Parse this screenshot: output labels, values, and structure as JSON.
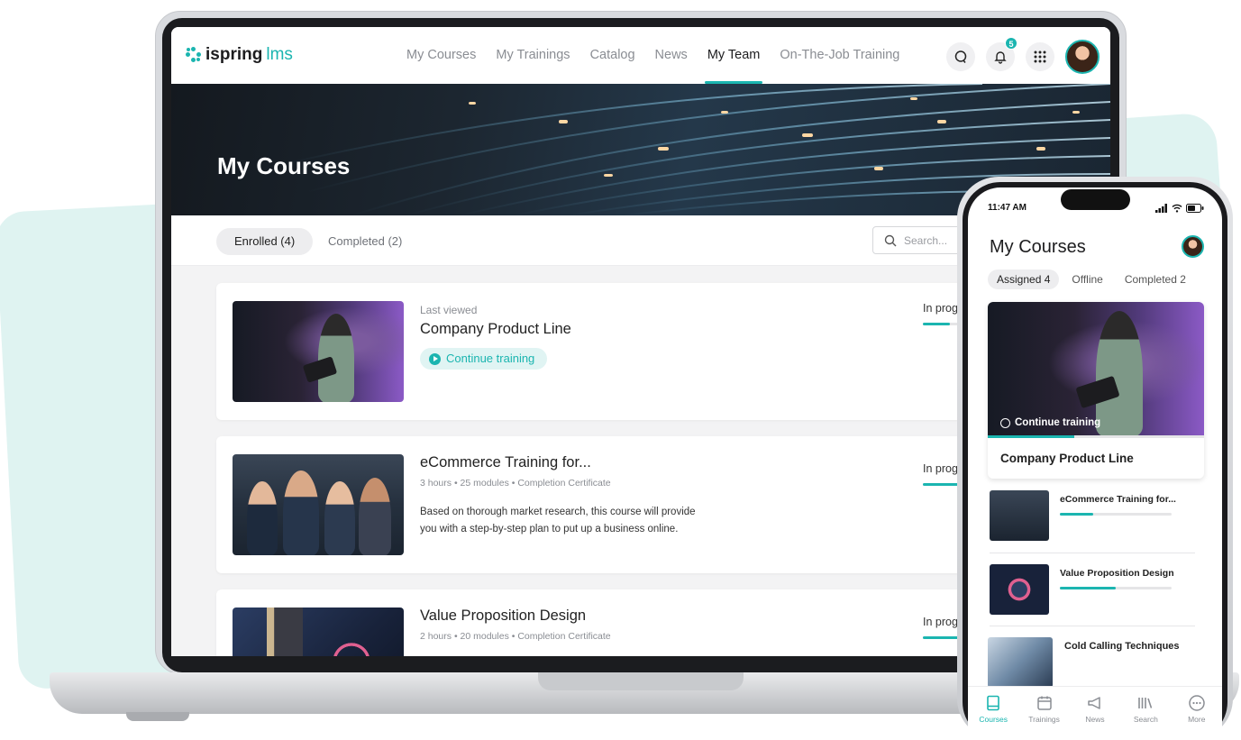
{
  "brand": {
    "name": "ispring",
    "suffix": "lms",
    "accent": "#1bb5b0"
  },
  "nav": {
    "items": [
      {
        "label": "My Courses"
      },
      {
        "label": "My Trainings"
      },
      {
        "label": "Catalog"
      },
      {
        "label": "News"
      },
      {
        "label": "My Team",
        "active": true
      },
      {
        "label": "On-The-Job Training"
      }
    ],
    "notifications_count": "5",
    "icons": [
      "chat-icon",
      "bell-icon",
      "apps-grid-icon",
      "user-avatar"
    ]
  },
  "banner": {
    "title": "My Courses"
  },
  "tabs": [
    {
      "label": "Enrolled (4)",
      "active": true
    },
    {
      "label": "Completed (2)",
      "active": false
    }
  ],
  "search": {
    "placeholder": "Search..."
  },
  "courses": [
    {
      "meta": "Last viewed",
      "title": "Company Product Line",
      "action": "Continue training",
      "status": "In prog",
      "progress": 0.5
    },
    {
      "title": "eCommerce Training for...",
      "meta": "3 hours • 25 modules  •  Completion Certificate",
      "description": "Based on thorough market research, this course will provide you with a step-by-step plan to put up a business online.",
      "status": "In prog",
      "progress": 0.7
    },
    {
      "title": "Value Proposition Design",
      "meta": "2 hours • 20 modules  •  Completion Certificate",
      "status": "In prog",
      "progress": 0.7
    }
  ],
  "phone": {
    "time": "11:47 AM",
    "title": "My Courses",
    "tabs": [
      {
        "label": "Assigned 4",
        "active": true
      },
      {
        "label": "Offline",
        "active": false
      },
      {
        "label": "Completed 2",
        "active": false
      }
    ],
    "hero": {
      "action": "Continue training",
      "title": "Company Product Line",
      "progress": 0.4
    },
    "list": [
      {
        "title": "eCommerce Training for...",
        "progress": 0.3
      },
      {
        "title": "Value Proposition Design",
        "progress": 0.5
      },
      {
        "title": "Cold Calling Techniques"
      }
    ],
    "bottom_nav": [
      {
        "label": "Courses",
        "icon": "book-icon",
        "active": true
      },
      {
        "label": "Trainings",
        "icon": "calendar-icon",
        "active": false
      },
      {
        "label": "News",
        "icon": "megaphone-icon",
        "active": false
      },
      {
        "label": "Search",
        "icon": "library-icon",
        "active": false
      },
      {
        "label": "More",
        "icon": "more-icon",
        "active": false
      }
    ]
  }
}
